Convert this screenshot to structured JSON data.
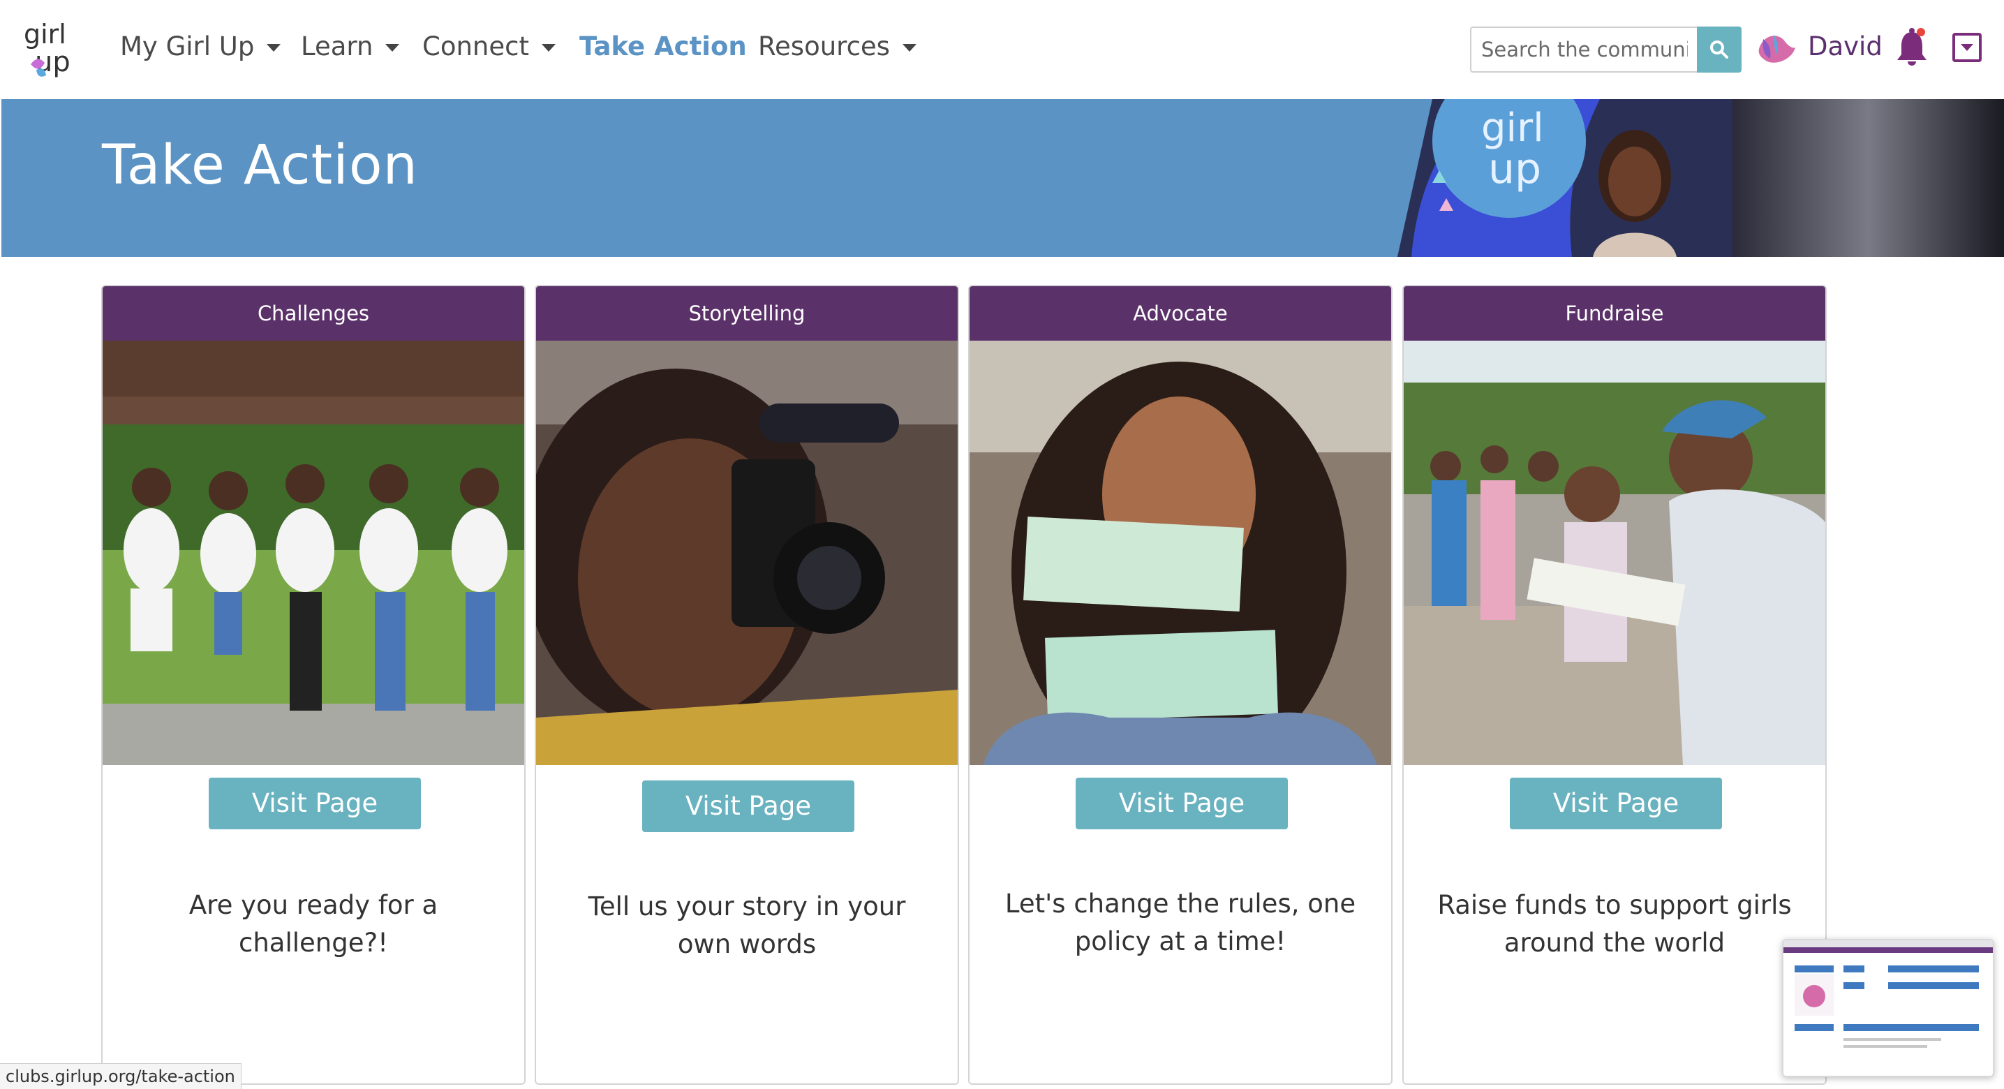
{
  "nav": {
    "items": [
      {
        "label": "My Girl Up"
      },
      {
        "label": "Learn"
      },
      {
        "label": "Connect"
      },
      {
        "label": "Take Action"
      },
      {
        "label": "Resources"
      }
    ],
    "search_placeholder": "Search the communi",
    "user_name": "David"
  },
  "hero": {
    "title": "Take Action"
  },
  "cards": [
    {
      "header": "Challenges",
      "button": "Visit Page",
      "text": "Are you ready for a challenge?!"
    },
    {
      "header": "Storytelling",
      "button": "Visit Page",
      "text": "Tell us your story in your own words"
    },
    {
      "header": "Advocate",
      "button": "Visit Page",
      "text": "Let's change the rules, one policy at a time!"
    },
    {
      "header": "Fundraise",
      "button": "Visit Page",
      "text": "Raise funds to support girls around the world"
    }
  ],
  "status_url": "clubs.girlup.org/take-action",
  "colors": {
    "primary_blue": "#5a93c4",
    "teal": "#69b2c0",
    "purple": "#5b3169",
    "user_purple": "#5b2e6d"
  }
}
